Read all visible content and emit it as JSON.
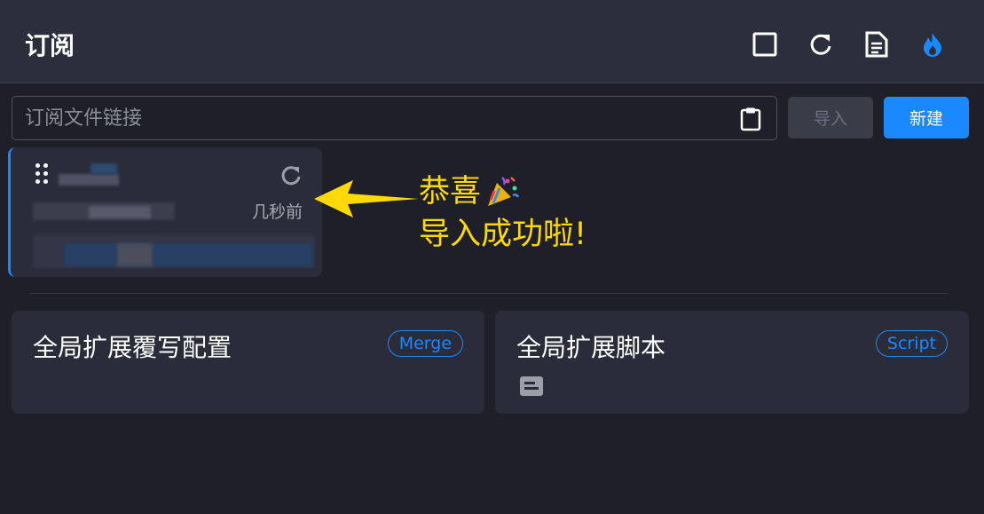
{
  "header": {
    "title": "订阅",
    "icons": [
      "checkbox-icon",
      "refresh-icon",
      "document-icon",
      "flame-icon"
    ]
  },
  "url_input": {
    "placeholder": "订阅文件链接",
    "value": ""
  },
  "buttons": {
    "import_label": "导入",
    "new_label": "新建"
  },
  "subscription_card": {
    "updated": "几秒前"
  },
  "annotation": {
    "line1": "恭喜",
    "line2": "导入成功啦!",
    "color": "#ffd900"
  },
  "extensions": [
    {
      "title": "全局扩展覆写配置",
      "badge": "Merge"
    },
    {
      "title": "全局扩展脚本",
      "badge": "Script"
    }
  ],
  "colors": {
    "accent": "#1a88ff",
    "background": "#1e1f29",
    "header": "#2b2e3b",
    "card": "#2a2c39"
  }
}
